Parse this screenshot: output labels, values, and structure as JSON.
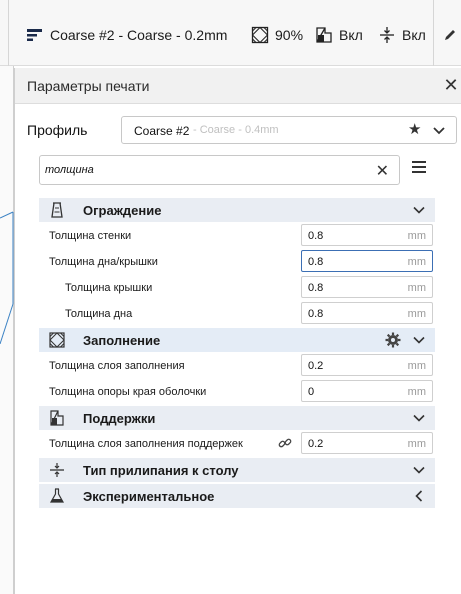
{
  "topbar": {
    "profile_label": "Coarse #2 - Coarse - 0.2mm",
    "infill_label": "90%",
    "support_label": "Вкл",
    "adhesion_label": "Вкл"
  },
  "panel": {
    "title": "Параметры печати",
    "profile_label": "Профиль",
    "profile_main": "Coarse #2",
    "profile_sub": "- Coarse - 0.4mm",
    "search_value": "толщина"
  },
  "sections": {
    "walls": {
      "label": "Ограждение"
    },
    "infill": {
      "label": "Заполнение"
    },
    "support": {
      "label": "Поддержки"
    },
    "adhesion": {
      "label": "Тип прилипания к столу"
    },
    "experimental": {
      "label": "Экспериментальное"
    }
  },
  "rows": {
    "wall_thickness": {
      "label": "Толщина стенки",
      "value": "0.8",
      "unit": "mm"
    },
    "top_bottom_thickness": {
      "label": "Толщина дна/крышки",
      "value": "0.8",
      "unit": "mm"
    },
    "top_thickness": {
      "label": "Толщина крышки",
      "value": "0.8",
      "unit": "mm"
    },
    "bottom_thickness": {
      "label": "Толщина дна",
      "value": "0.8",
      "unit": "mm"
    },
    "infill_layer_thickness": {
      "label": "Толщина слоя заполнения",
      "value": "0.2",
      "unit": "mm"
    },
    "skin_edge_support_thickness": {
      "label": "Толщина опоры края оболочки",
      "value": "0",
      "unit": "mm"
    },
    "support_infill_layer_thickness": {
      "label": "Толщина слоя заполнения поддержек",
      "value": "0.2",
      "unit": "mm"
    }
  },
  "colors": {
    "accent": "#3c6fb4",
    "section_bg": "#e9edf3"
  }
}
